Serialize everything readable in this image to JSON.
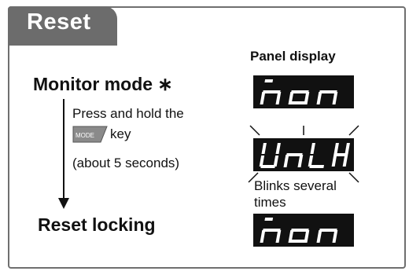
{
  "section": {
    "title": "Reset"
  },
  "panel_display_label": "Panel display",
  "monitor_mode_label": "Monitor mode ∗",
  "instruction": {
    "line1": "Press and hold the",
    "key_name": "MODE",
    "line2_suffix": "key",
    "line3": "(about 5 seconds)"
  },
  "reset_locking_label": "Reset locking",
  "blink_note": {
    "line1": "Blinks several",
    "line2": "times"
  },
  "displays": {
    "top": "nOn",
    "middle": "UnLK",
    "bottom": "nOn"
  },
  "colors": {
    "tab": "#6c6c6c",
    "frame": "#6f6f6f",
    "display_bg": "#111111",
    "segment": "#ffffff",
    "key": "#8a8a8a"
  }
}
